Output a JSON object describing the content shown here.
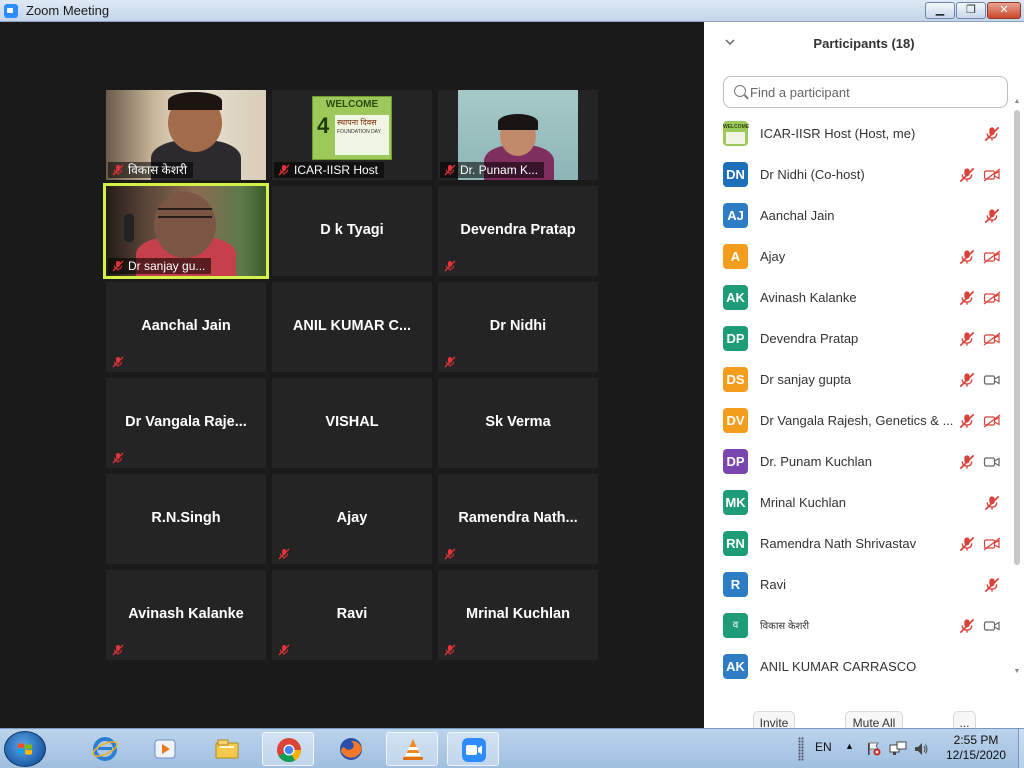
{
  "window": {
    "title": "Zoom Meeting",
    "minimize_icon": "minimize-icon",
    "maximize_icon": "restore-icon",
    "close_icon": "close-icon"
  },
  "gallery": {
    "tiles": [
      {
        "name": "विकास केशरी",
        "video": true,
        "muted": true
      },
      {
        "name": "ICAR-IISR Host",
        "video": true,
        "muted": true
      },
      {
        "name": "Dr. Punam K...",
        "video": true,
        "muted": true
      },
      {
        "name": "Dr sanjay gu...",
        "video": true,
        "muted": true,
        "active_speaker": true
      },
      {
        "name": "D k Tyagi",
        "video": false,
        "muted": false
      },
      {
        "name": "Devendra Pratap",
        "video": false,
        "muted": true
      },
      {
        "name": "Aanchal Jain",
        "video": false,
        "muted": true
      },
      {
        "name": "ANIL KUMAR C...",
        "video": false,
        "muted": false
      },
      {
        "name": "Dr Nidhi",
        "video": false,
        "muted": true
      },
      {
        "name": "Dr  Vangala  Raje...",
        "video": false,
        "muted": true
      },
      {
        "name": "VISHAL",
        "video": false,
        "muted": false
      },
      {
        "name": "Sk Verma",
        "video": false,
        "muted": false
      },
      {
        "name": "R.N.Singh",
        "video": false,
        "muted": false
      },
      {
        "name": "Ajay",
        "video": false,
        "muted": true
      },
      {
        "name": "Ramendra  Nath...",
        "video": false,
        "muted": true
      },
      {
        "name": "Avinash Kalanke",
        "video": false,
        "muted": true
      },
      {
        "name": "Ravi",
        "video": false,
        "muted": true
      },
      {
        "name": "Mrinal Kuchlan",
        "video": false,
        "muted": true
      }
    ],
    "welcome_banner": {
      "line1": "WELCOME",
      "line2": "स्थापना दिवस",
      "line3": "FOUNDATION DAY",
      "number": "4"
    }
  },
  "participants": {
    "title": "Participants (18)",
    "search_placeholder": "Find a participant",
    "list": [
      {
        "initials": "",
        "name": "ICAR-IISR Host (Host, me)",
        "color": "#7fae3a",
        "mic": "muted",
        "cam": "none",
        "logo": true
      },
      {
        "initials": "DN",
        "name": "Dr Nidhi (Co-host)",
        "color": "#1c6fb8",
        "mic": "muted",
        "cam": "off"
      },
      {
        "initials": "AJ",
        "name": "Aanchal Jain",
        "color": "#2d7cc4",
        "mic": "muted",
        "cam": "none"
      },
      {
        "initials": "A",
        "name": "Ajay",
        "color": "#f29d1c",
        "mic": "muted",
        "cam": "off"
      },
      {
        "initials": "AK",
        "name": "Avinash Kalanke",
        "color": "#1e9b77",
        "mic": "muted",
        "cam": "off"
      },
      {
        "initials": "DP",
        "name": "Devendra Pratap",
        "color": "#1e9b77",
        "mic": "muted",
        "cam": "off"
      },
      {
        "initials": "DS",
        "name": "Dr sanjay gupta",
        "color": "#f29d1c",
        "mic": "muted",
        "cam": "on"
      },
      {
        "initials": "DV",
        "name": "Dr Vangala Rajesh, Genetics & ...",
        "color": "#f29d1c",
        "mic": "muted",
        "cam": "off"
      },
      {
        "initials": "DP",
        "name": "Dr. Punam Kuchlan",
        "color": "#7b45b0",
        "mic": "muted",
        "cam": "on"
      },
      {
        "initials": "MK",
        "name": "Mrinal Kuchlan",
        "color": "#1e9b77",
        "mic": "muted",
        "cam": "none"
      },
      {
        "initials": "RN",
        "name": "Ramendra Nath Shrivastav",
        "color": "#1e9b77",
        "mic": "muted",
        "cam": "off"
      },
      {
        "initials": "R",
        "name": "Ravi",
        "color": "#2d7cc4",
        "mic": "muted",
        "cam": "none"
      },
      {
        "initials": "व",
        "name": "विकास केशरी",
        "color": "#1e9b77",
        "mic": "muted",
        "cam": "on"
      },
      {
        "initials": "AK",
        "name": "ANIL KUMAR CARRASCO",
        "color": "#2d7cc4",
        "mic": "none",
        "cam": "none"
      }
    ],
    "buttons": {
      "invite": "Invite",
      "mute_all": "Mute All",
      "more": "..."
    }
  },
  "taskbar": {
    "language": "EN",
    "time": "2:55 PM",
    "date": "12/15/2020",
    "apps": [
      "internet-explorer-icon",
      "media-player-icon",
      "file-explorer-icon",
      "chrome-icon",
      "firefox-icon",
      "vlc-icon",
      "zoom-icon"
    ]
  }
}
